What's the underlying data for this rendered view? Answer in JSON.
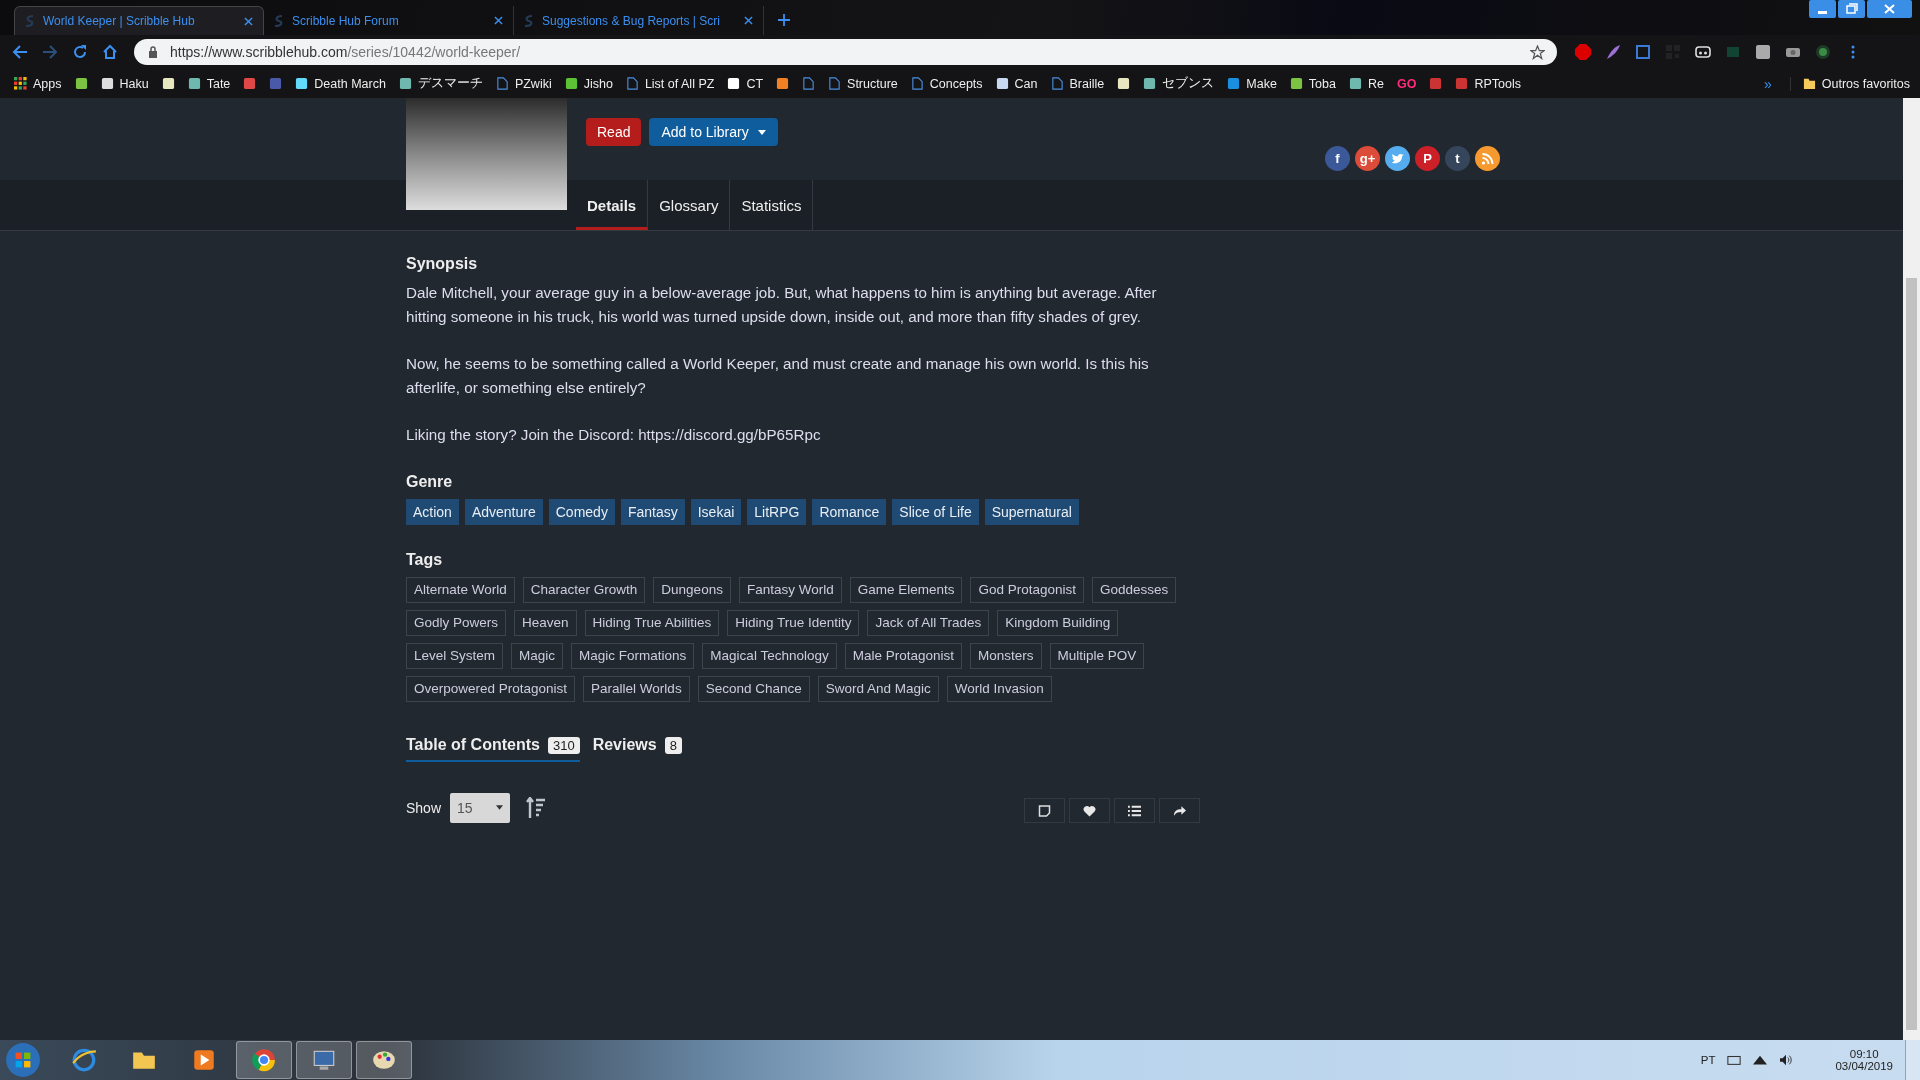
{
  "browser": {
    "tabs": [
      {
        "title": "World Keeper | Scribble Hub",
        "selected": true
      },
      {
        "title": "Scribble Hub Forum",
        "selected": false
      },
      {
        "title": "Suggestions & Bug Reports | Scri",
        "selected": false
      }
    ],
    "url_host": "https://www.scribblehub.com",
    "url_path": "/series/10442/world-keeper/",
    "bookmarks": [
      {
        "label": "Apps",
        "kind": "apps"
      },
      {
        "kind": "icon",
        "color": "#7cc243"
      },
      {
        "label": "Haku",
        "kind": "icon",
        "color": "#dddddd"
      },
      {
        "kind": "icon",
        "color": "#e8e8c0"
      },
      {
        "label": "Tate",
        "kind": "icon",
        "color": "#6fb8b0"
      },
      {
        "kind": "icon",
        "color": "#e04848"
      },
      {
        "kind": "icon",
        "color": "#4a5aa8"
      },
      {
        "label": "Death March",
        "kind": "icon",
        "color": "#61dafb"
      },
      {
        "label": "デスマーチ",
        "kind": "icon",
        "color": "#6fb8b0"
      },
      {
        "label": "PZwiki",
        "kind": "page"
      },
      {
        "label": "Jisho",
        "kind": "icon",
        "color": "#5cc236"
      },
      {
        "label": "List of All PZ",
        "kind": "page"
      },
      {
        "label": "CT",
        "kind": "icon",
        "color": "#ffffff"
      },
      {
        "kind": "icon",
        "color": "#f48024"
      },
      {
        "kind": "page"
      },
      {
        "label": "Structure",
        "kind": "page"
      },
      {
        "label": "Concepts",
        "kind": "page"
      },
      {
        "label": "Can",
        "kind": "icon",
        "color": "#c8d8f0"
      },
      {
        "label": "Braille",
        "kind": "page"
      },
      {
        "kind": "icon",
        "color": "#e8e8c0"
      },
      {
        "label": "セブンス",
        "kind": "icon",
        "color": "#6fb8b0"
      },
      {
        "label": "Make",
        "kind": "icon",
        "color": "#1a8fe0"
      },
      {
        "label": "Toba",
        "kind": "icon",
        "color": "#7cc243"
      },
      {
        "label": "Re",
        "kind": "icon",
        "color": "#6fb8b0"
      },
      {
        "label": "GO",
        "kind": "logo"
      },
      {
        "kind": "icon",
        "color": "#cc3333"
      },
      {
        "label": "RPTools",
        "kind": "icon",
        "color": "#cc3333"
      }
    ],
    "more": "»",
    "other_bookmarks": "Outros favoritos"
  },
  "series": {
    "actions": [
      {
        "label": "Read",
        "kind": "read"
      },
      {
        "label": "Add to Library",
        "kind": "library"
      }
    ],
    "share": [
      {
        "kind": "letter",
        "glyph": "f",
        "color": "#3b5998"
      },
      {
        "kind": "letter",
        "glyph": "g+",
        "color": "#dd4b39"
      },
      {
        "kind": "bird",
        "color": "#55acee"
      },
      {
        "kind": "letter",
        "glyph": "P",
        "color": "#cb2027"
      },
      {
        "kind": "letter",
        "glyph": "t",
        "color": "#35465c"
      },
      {
        "kind": "feed",
        "color": "#f69a30"
      }
    ],
    "tabs": [
      {
        "label": "Details",
        "selected": true
      },
      {
        "label": "Glossary",
        "selected": false
      },
      {
        "label": "Statistics",
        "selected": false
      }
    ],
    "synopsis_title": "Synopsis",
    "synopsis": [
      "Dale Mitchell, your average guy in a below-average job. But, what happens to him is anything but average. After hitting someone in his truck, his world was turned upside down, inside out, and more than fifty shades of grey.",
      "Now, he seems to be something called a World Keeper, and must create and manage his own world. Is this his afterlife, or something else entirely?",
      "Liking the story? Join the Discord: https://discord.gg/bP65Rpc"
    ],
    "genre_title": "Genre",
    "genres": [
      "Action",
      "Adventure",
      "Comedy",
      "Fantasy",
      "Isekai",
      "LitRPG",
      "Romance",
      "Slice of Life",
      "Supernatural"
    ],
    "tags_title": "Tags",
    "tags": [
      "Alternate World",
      "Character Growth",
      "Dungeons",
      "Fantasy World",
      "Game Elements",
      "God Protagonist",
      "Goddesses",
      "Godly Powers",
      "Heaven",
      "Hiding True Abilities",
      "Hiding True Identity",
      "Jack of All Trades",
      "Kingdom Building",
      "Level System",
      "Magic",
      "Magic Formations",
      "Magical Technology",
      "Male Protagonist",
      "Monsters",
      "Multiple POV",
      "Overpowered Protagonist",
      "Parallel Worlds",
      "Second Chance",
      "Sword And Magic",
      "World Invasion"
    ],
    "content_tabs": [
      {
        "label": "Table of Contents",
        "count": "310",
        "selected": true
      },
      {
        "label": "Reviews",
        "count": "8",
        "selected": false
      }
    ],
    "show_label": "Show",
    "show_value": "15"
  },
  "taskbar": {
    "language": "PT",
    "time": "09:10",
    "date": "03/04/2019"
  }
}
